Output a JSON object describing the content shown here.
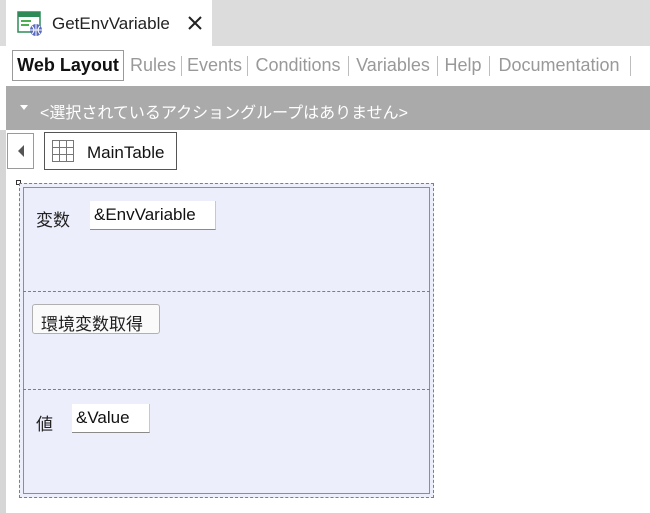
{
  "document_tab": {
    "title": "GetEnvVariable",
    "icon": "webpanel-icon",
    "close_glyph": "✕"
  },
  "designer_tabs": [
    {
      "label": "Web Layout",
      "active": true
    },
    {
      "label": "Rules",
      "active": false
    },
    {
      "label": "Events",
      "active": false
    },
    {
      "label": "Conditions",
      "active": false
    },
    {
      "label": "Variables",
      "active": false
    },
    {
      "label": "Help",
      "active": false
    },
    {
      "label": "Documentation",
      "active": false
    }
  ],
  "action_group": {
    "text": "<選択されているアクショングループはありません>"
  },
  "breadcrumb": {
    "label": "MainTable",
    "icon": "table-grid-icon"
  },
  "main_table": {
    "row1": {
      "label": "変数",
      "field_value": "&EnvVariable"
    },
    "row2": {
      "button_label": "環境変数取得"
    },
    "row3": {
      "label": "値",
      "field_value": "&Value"
    }
  },
  "colors": {
    "active_tab_text": "#111111",
    "inactive_tab_text": "#999999",
    "action_bar": "#aaaaaa",
    "table_background": "#eceefc",
    "table_border": "#6a7db8"
  }
}
